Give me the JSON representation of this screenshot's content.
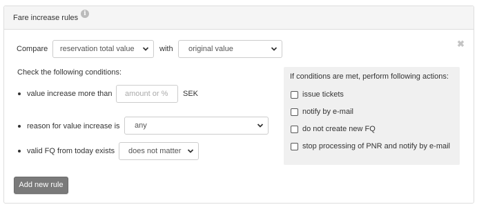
{
  "panel": {
    "title": "Fare increase rules",
    "info_icon": "info-circle-icon",
    "close_icon": "close-icon"
  },
  "compare": {
    "label": "Compare",
    "selected": "reservation total value",
    "with_label": "with",
    "with_selected": "original value"
  },
  "conditions": {
    "heading": "Check the following conditions:",
    "items": [
      {
        "label": "value increase more than",
        "placeholder": "amount or %",
        "unit": "SEK"
      },
      {
        "label": "reason for value increase is",
        "selected": "any"
      },
      {
        "label": "valid FQ from today exists",
        "selected": "does not matter"
      }
    ]
  },
  "actions": {
    "heading": "If conditions are met, perform following actions:",
    "items": [
      {
        "label": "issue tickets",
        "checked": false
      },
      {
        "label": "notify by e-mail",
        "checked": false
      },
      {
        "label": "do not create new FQ",
        "checked": false
      },
      {
        "label": "stop processing of PNR and notify by e-mail",
        "checked": false
      }
    ]
  },
  "add_button": {
    "label": "Add new rule"
  },
  "colors": {
    "panel_header_bg": "#f5f5f5",
    "actions_bg": "#f0f0f0",
    "button_bg": "#7a7a7a",
    "border": "#cccccc"
  }
}
